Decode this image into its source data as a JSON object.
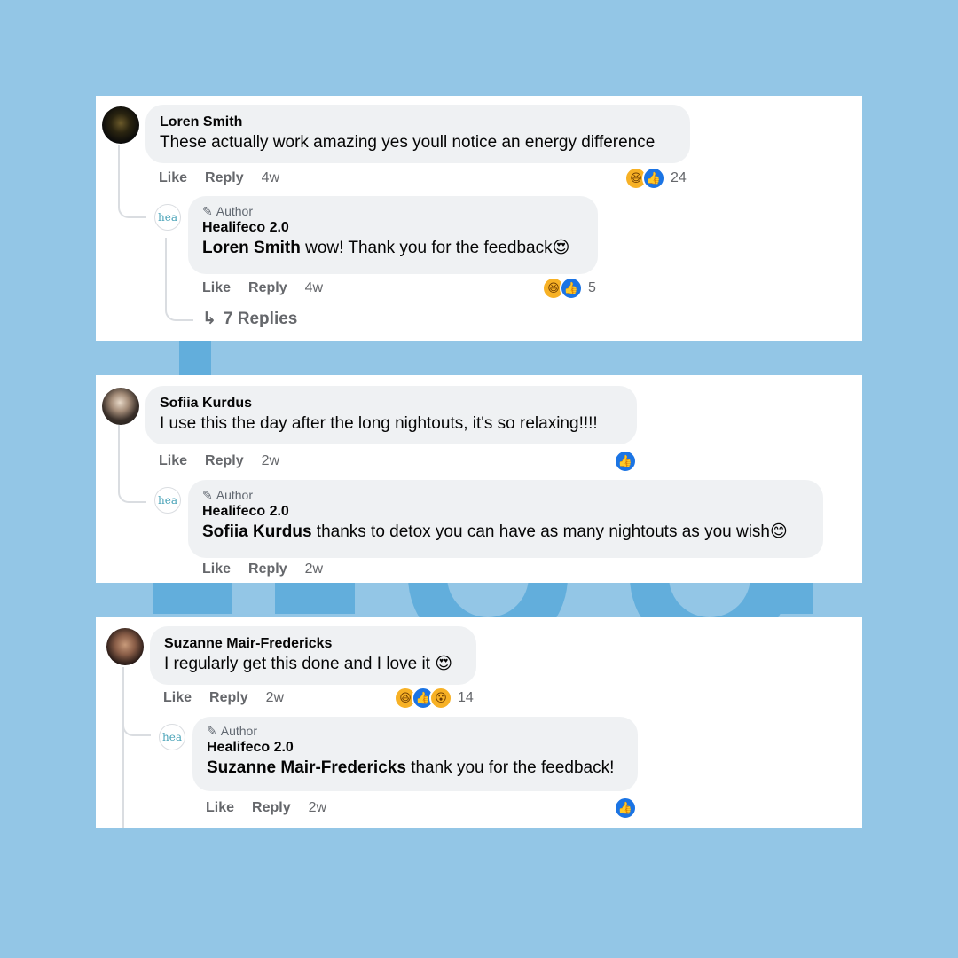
{
  "threads": [
    {
      "comment": {
        "name": "Loren Smith",
        "text": "These actually work amazing yes youll notice an energy difference",
        "like": "Like",
        "reply": "Reply",
        "time": "4w",
        "react_count": "24"
      },
      "reply": {
        "author_label": "Author",
        "name": "Healifeco 2.0",
        "mention": "Loren Smith",
        "text": " wow! Thank you for the feedback😍",
        "like": "Like",
        "reply": "Reply",
        "time": "4w",
        "react_count": "5",
        "logo_text": "hea"
      },
      "more_replies": "7 Replies"
    },
    {
      "comment": {
        "name": "Sofiia Kurdus",
        "text": "I use this the day after the long nightouts, it's so relaxing!!!!",
        "like": "Like",
        "reply": "Reply",
        "time": "2w"
      },
      "reply": {
        "author_label": "Author",
        "name": "Healifeco 2.0",
        "mention": "Sofiia Kurdus",
        "text": " thanks to detox you can have as many nightouts as you wish😊",
        "like": "Like",
        "reply": "Reply",
        "time": "2w",
        "logo_text": "hea"
      }
    },
    {
      "comment": {
        "name": "Suzanne Mair-Fredericks",
        "text": "I regularly get this done and I love it 😍",
        "like": "Like",
        "reply": "Reply",
        "time": "2w",
        "react_count": "14"
      },
      "reply": {
        "author_label": "Author",
        "name": "Healifeco 2.0",
        "mention": "Suzanne Mair-Fredericks",
        "text": " thank you for the feedback!",
        "like": "Like",
        "reply": "Reply",
        "time": "2w",
        "logo_text": "hea"
      }
    }
  ],
  "icons": {
    "like": "👍",
    "haha": "😆",
    "wow": "😮",
    "pen": "✎",
    "reply_arrow": "↳"
  },
  "colors": {
    "background": "#93c6e6",
    "background_shapes": "#62aedc",
    "panel": "#ffffff",
    "bubble": "#eff1f3",
    "like_blue": "#1b74e4"
  }
}
